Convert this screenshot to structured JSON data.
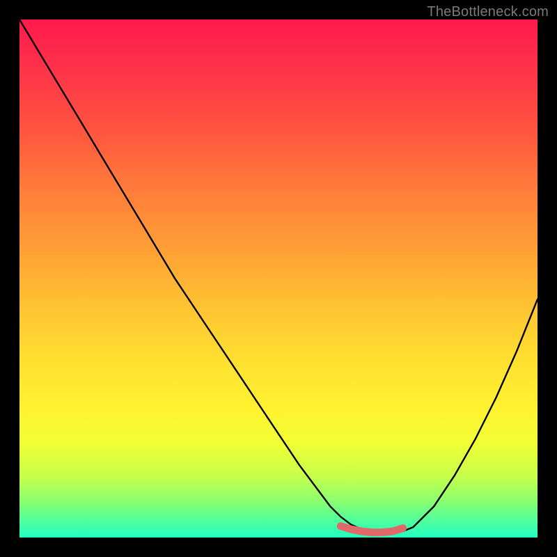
{
  "watermark": "TheBottleneck.com",
  "chart_data": {
    "type": "line",
    "title": "",
    "xlabel": "",
    "ylabel": "",
    "xlim": [
      0,
      100
    ],
    "ylim": [
      0,
      100
    ],
    "grid": false,
    "legend": false,
    "series": [
      {
        "name": "bottleneck-curve",
        "color": "#000000",
        "x": [
          0,
          6,
          12,
          18,
          24,
          30,
          36,
          42,
          48,
          54,
          60,
          62,
          64,
          66,
          68,
          70,
          72,
          74,
          76,
          80,
          84,
          88,
          92,
          96,
          100
        ],
        "y": [
          100,
          90,
          80,
          70,
          60,
          50,
          41,
          32,
          23,
          14,
          6,
          4,
          2.5,
          1.6,
          1.2,
          1.0,
          1.0,
          1.2,
          2.0,
          6,
          12,
          19,
          27,
          36,
          46
        ]
      },
      {
        "name": "optimal-zone",
        "color": "#e06a6a",
        "x": [
          62,
          64,
          66,
          68,
          70,
          72,
          74
        ],
        "y": [
          2.2,
          1.6,
          1.2,
          1.0,
          1.0,
          1.2,
          1.8
        ]
      }
    ],
    "background_gradient": {
      "top": "#ff1a4d",
      "mid": "#ffe030",
      "bottom": "#22ffc2"
    }
  }
}
